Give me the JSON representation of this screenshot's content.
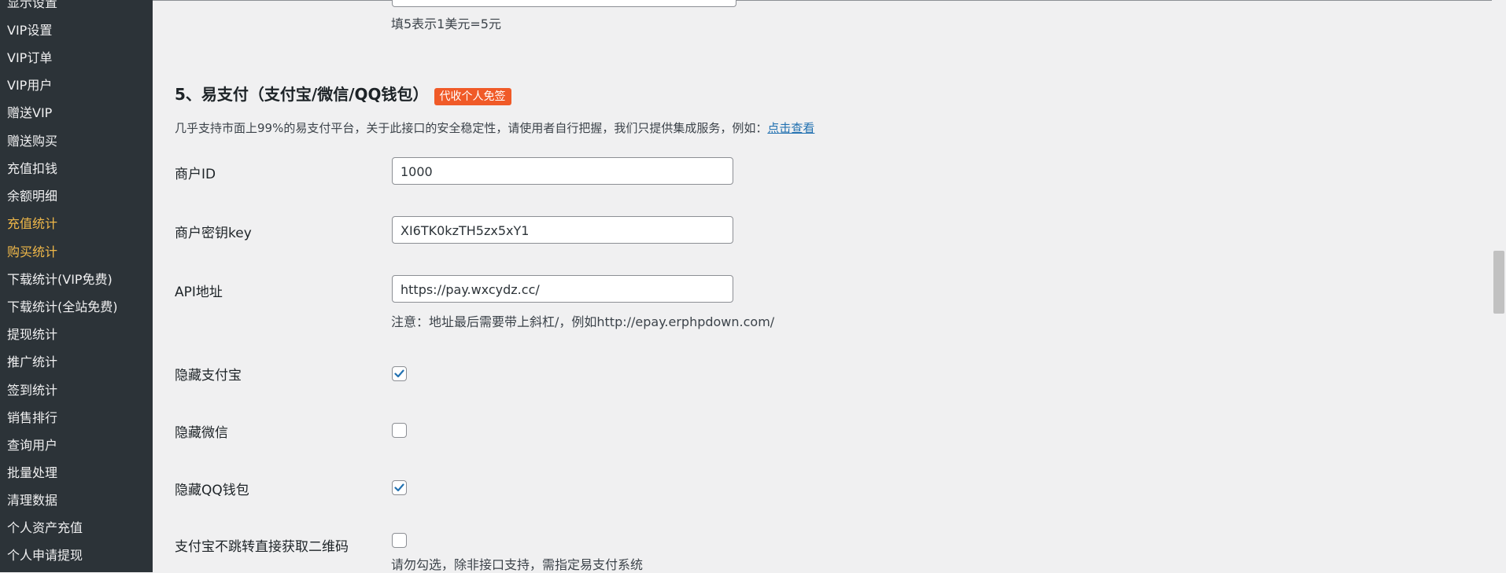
{
  "sidebar": {
    "items": [
      {
        "label": "显示设置",
        "active": false
      },
      {
        "label": "VIP设置",
        "active": false
      },
      {
        "label": "VIP订单",
        "active": false
      },
      {
        "label": "VIP用户",
        "active": false
      },
      {
        "label": "赠送VIP",
        "active": false
      },
      {
        "label": "赠送购买",
        "active": false
      },
      {
        "label": "充值扣钱",
        "active": false
      },
      {
        "label": "余额明细",
        "active": false
      },
      {
        "label": "充值统计",
        "active": true
      },
      {
        "label": "购买统计",
        "active": true
      },
      {
        "label": "下载统计(VIP免费)",
        "active": false
      },
      {
        "label": "下载统计(全站免费)",
        "active": false
      },
      {
        "label": "提现统计",
        "active": false
      },
      {
        "label": "推广统计",
        "active": false
      },
      {
        "label": "签到统计",
        "active": false
      },
      {
        "label": "销售排行",
        "active": false
      },
      {
        "label": "查询用户",
        "active": false
      },
      {
        "label": "批量处理",
        "active": false
      },
      {
        "label": "清理数据",
        "active": false
      },
      {
        "label": "个人资产充值",
        "active": false
      },
      {
        "label": "个人申请提现",
        "active": false
      }
    ]
  },
  "main": {
    "rate_note": "填5表示1美元=5元",
    "section": {
      "title": "5、易支付（支付宝/微信/QQ钱包）",
      "badge": "代收个人免签",
      "intro": "几乎支持市面上99%的易支付平台，关于此接口的安全稳定性，请使用者自行把握，我们只提供集成服务，例如：",
      "intro_link": "点击查看"
    },
    "fields": {
      "merchant_id": {
        "label": "商户ID",
        "value": "1000"
      },
      "merchant_key": {
        "label": "商户密钥key",
        "value": "XI6TK0kzTH5zx5xY1"
      },
      "api_url": {
        "label": "API地址",
        "value": "https://pay.wxcydz.cc/",
        "note": "注意：地址最后需要带上斜杠/，例如http://epay.erphpdown.com/"
      },
      "hide_alipay": {
        "label": "隐藏支付宝",
        "checked": true
      },
      "hide_wechat": {
        "label": "隐藏微信",
        "checked": false
      },
      "hide_qq": {
        "label": "隐藏QQ钱包",
        "checked": true
      },
      "alipay_qrcode": {
        "label": "支付宝不跳转直接获取二维码",
        "checked": false,
        "note": "请勿勾选，除非接口支持，需指定易支付系统"
      }
    }
  },
  "colors": {
    "sidebar_bg": "#2c3338",
    "sidebar_active": "#f0b849",
    "badge_bg": "#f05a28",
    "link": "#2271b1",
    "checkmark": "#2271b1"
  },
  "icons": {
    "checkmark": "check-icon"
  }
}
